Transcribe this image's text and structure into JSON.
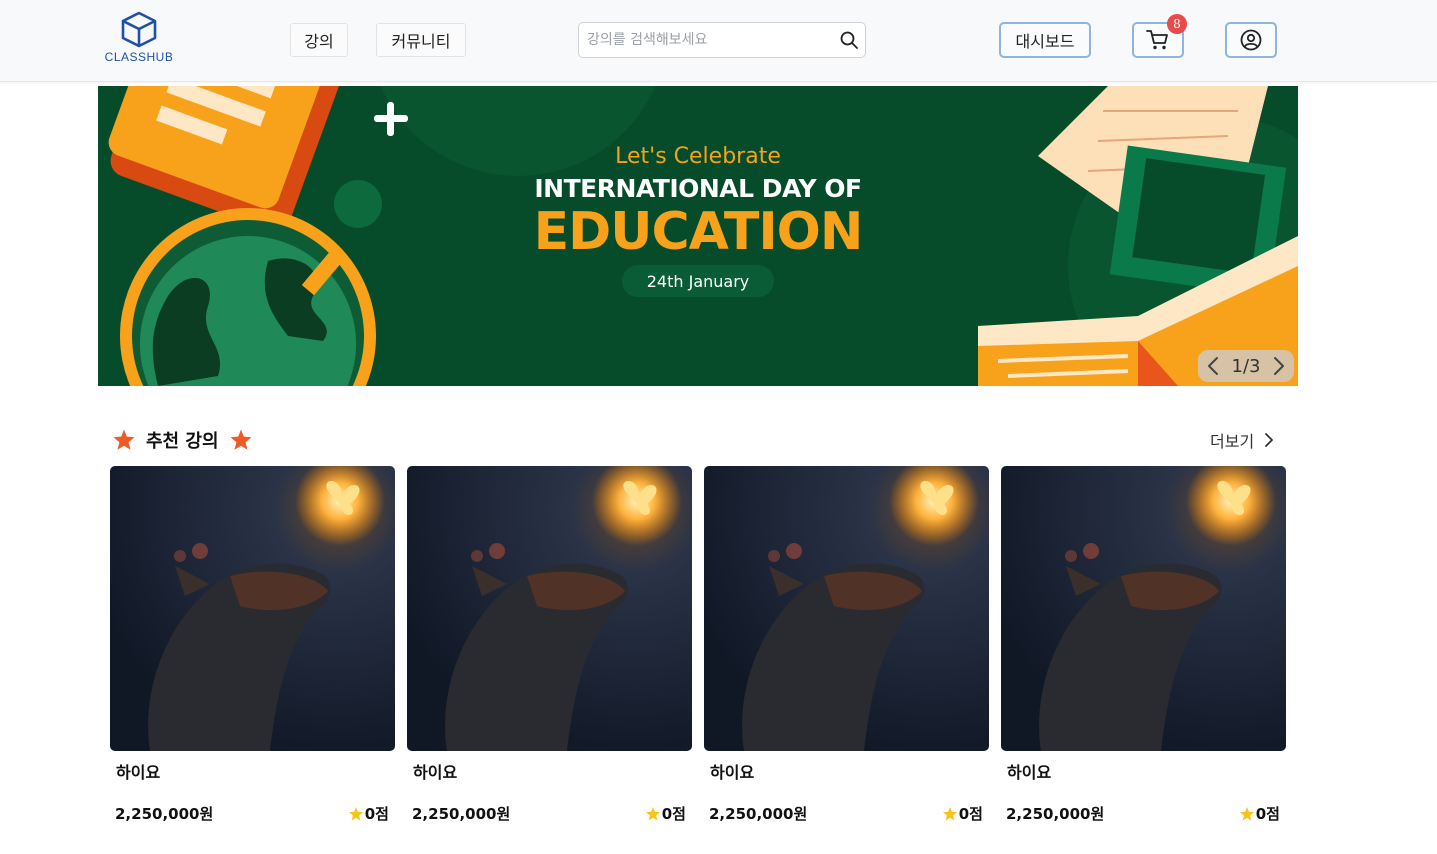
{
  "header": {
    "logo_text": "CLASSHUB",
    "nav": {
      "lecture": "강의",
      "community": "커뮤니티"
    },
    "search": {
      "placeholder": "강의를 검색해보세요",
      "value": ""
    },
    "dashboard_label": "대시보드",
    "cart_count": "8",
    "icons": [
      "cube-logo-icon",
      "search-icon",
      "cart-icon",
      "user-icon"
    ]
  },
  "banner": {
    "subtitle": "Let's Celebrate",
    "title_line1": "INTERNATIONAL DAY OF",
    "title_line2": "EDUCATION",
    "date": "24th January",
    "pager": "1/3"
  },
  "section": {
    "title": "추천 강의",
    "more": "더보기"
  },
  "courses": [
    {
      "title": "하이요",
      "price": "2,250,000원",
      "rating": "0점"
    },
    {
      "title": "하이요",
      "price": "2,250,000원",
      "rating": "0점"
    },
    {
      "title": "하이요",
      "price": "2,250,000원",
      "rating": "0점"
    },
    {
      "title": "하이요",
      "price": "2,250,000원",
      "rating": "0점"
    }
  ],
  "colors": {
    "brand_blue": "#1f4fa8",
    "button_border": "#8fb4de",
    "badge_red": "#e74b4b",
    "banner_green": "#064c2b",
    "banner_orange": "#f7a21a",
    "star_orange": "#f05a24",
    "star_yellow": "#f5c518"
  }
}
